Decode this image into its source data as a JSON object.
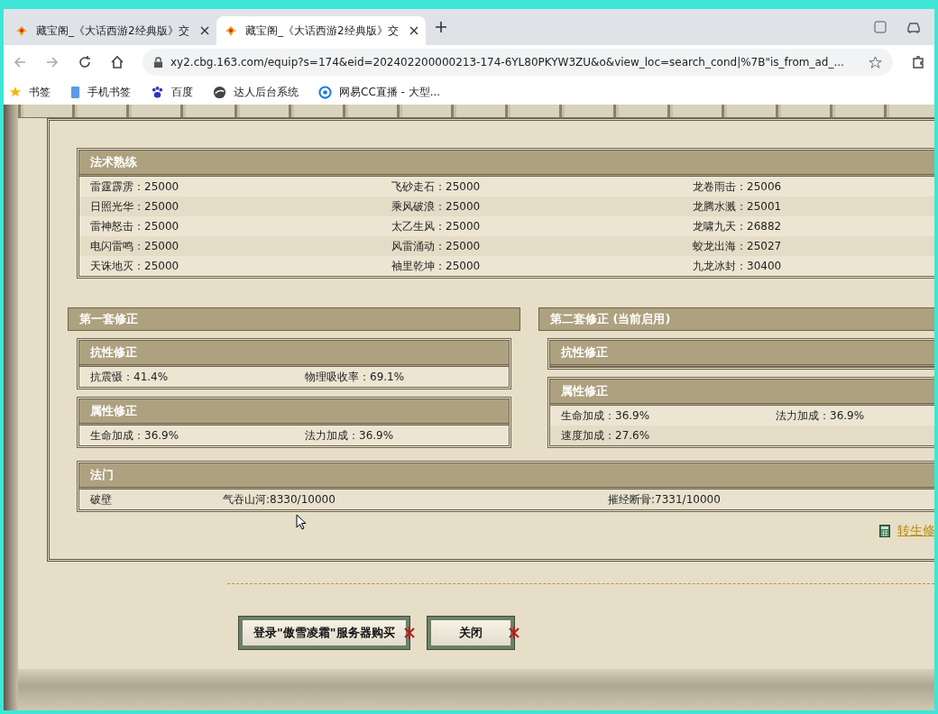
{
  "browser": {
    "tabs": [
      {
        "title": "藏宝阁_《大话西游2经典版》交",
        "selected": false
      },
      {
        "title": "藏宝阁_《大话西游2经典版》交",
        "selected": true
      }
    ],
    "url": "xy2.cbg.163.com/equip?s=174&eid=202402200000213-174-6YL80PKYW3ZU&o&view_loc=search_cond|%7B\"is_from_ad_...",
    "bookmarks": [
      {
        "label": "书签",
        "kind": "star"
      },
      {
        "label": "手机书签",
        "kind": "phone"
      },
      {
        "label": "百度",
        "kind": "paw"
      },
      {
        "label": "达人后台系统",
        "kind": "globe"
      },
      {
        "label": "网易CC直播 - 大型...",
        "kind": "cc"
      }
    ]
  },
  "skills": {
    "title": "法术熟练",
    "rows": [
      [
        "雷霆霹雳：25000",
        "飞砂走石：25000",
        "龙卷雨击：25006"
      ],
      [
        "日照光华：25000",
        "乘风破浪：25000",
        "龙腾水溅：25001"
      ],
      [
        "雷神怒击：25000",
        "太乙生风：25000",
        "龙啸九天：26882"
      ],
      [
        "电闪雷鸣：25000",
        "风雷涌动：25000",
        "蛟龙出海：25027"
      ],
      [
        "天诛地灭：25000",
        "袖里乾坤：25000",
        "九龙冰封：30400"
      ]
    ]
  },
  "corrections": [
    {
      "title": "第一套修正",
      "groups": [
        {
          "title": "抗性修正",
          "rows": [
            [
              "抗震慑：41.4%",
              "物理吸收率：69.1%"
            ]
          ]
        },
        {
          "title": "属性修正",
          "rows": [
            [
              "生命加成：36.9%",
              "法力加成：36.9%"
            ]
          ]
        }
      ]
    },
    {
      "title": "第二套修正 (当前启用)",
      "groups": [
        {
          "title": "抗性修正"
        },
        {
          "title": "属性修正",
          "rows": [
            [
              "生命加成：36.9%",
              "法力加成：36.9%"
            ],
            [
              "速度加成：27.6%"
            ]
          ]
        }
      ]
    }
  ],
  "famen": {
    "title": "法门",
    "items": [
      "破壁",
      "气吞山河:8330/10000",
      "摧经断骨:7331/10000"
    ]
  },
  "link": "转生修",
  "buttons": [
    "登录\"傲雪凌霜\"服务器购买",
    "关闭"
  ]
}
